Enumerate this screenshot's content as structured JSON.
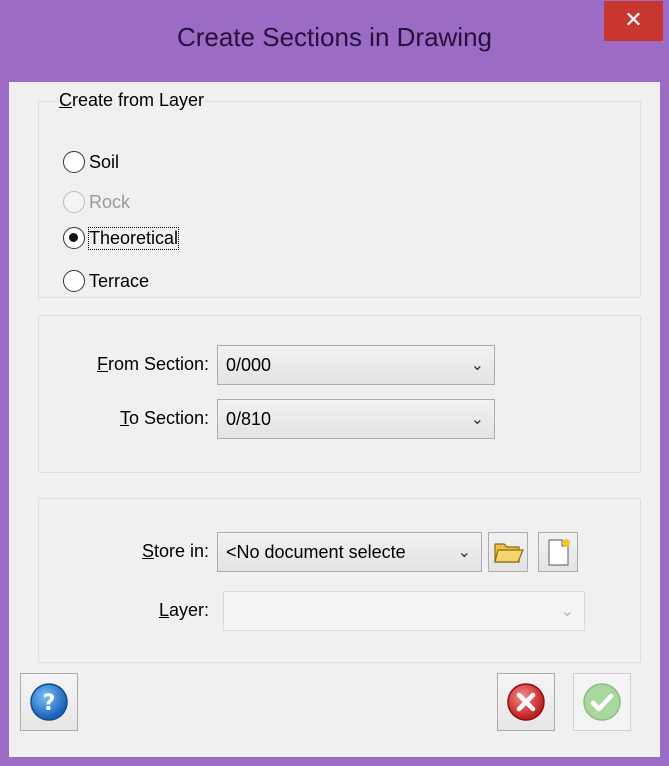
{
  "window": {
    "title": "Create Sections  in Drawing",
    "close_glyph": "✕"
  },
  "layer_group": {
    "legend_prefix": "C",
    "legend_rest": "reate from Layer",
    "options": [
      {
        "label": "Soil",
        "checked": false,
        "disabled": false
      },
      {
        "label": "Rock",
        "checked": false,
        "disabled": true
      },
      {
        "label": "Theoretical",
        "checked": true,
        "disabled": false
      },
      {
        "label": "Terrace",
        "checked": false,
        "disabled": false
      }
    ]
  },
  "section_group": {
    "from_label_prefix": "F",
    "from_label_rest": "rom Section:",
    "from_value": "0/000",
    "to_label_prefix": "T",
    "to_label_rest": "o Section:",
    "to_value": "0/810"
  },
  "store_group": {
    "store_label_prefix": "S",
    "store_label_rest": "tore in:",
    "store_value": "<No document selecte",
    "layer_label_prefix": "L",
    "layer_label_rest": "ayer:",
    "layer_value": ""
  },
  "icons": {
    "open_folder": "folder-open-icon",
    "new_document": "new-document-icon",
    "help": "help-icon",
    "cancel": "cancel-icon",
    "ok": "ok-check-icon"
  },
  "colors": {
    "window_frame": "#9C6BC6",
    "close_button": "#C7372F",
    "client_bg": "#F0F0F0"
  }
}
